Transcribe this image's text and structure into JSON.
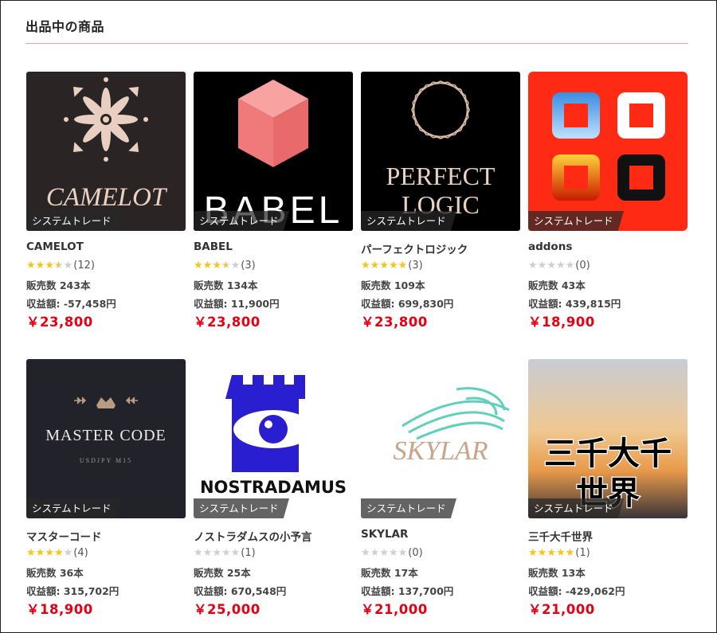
{
  "page": {
    "title": "出品中の商品"
  },
  "colors": {
    "price": "#e60012",
    "star": "#f5c518",
    "star_empty": "#cfcfcf",
    "rule": "#f2a4a4"
  },
  "products": [
    {
      "name": "CAMELOT",
      "tag": "システムトレード",
      "rating": 3.5,
      "reviews": "(12)",
      "sales": "販売数 243本",
      "profit": "収益額: -57,458円",
      "price": "￥23,800",
      "thumb": {
        "bg": "#2a2524",
        "art": "ornament",
        "label": "CAMELOT"
      }
    },
    {
      "name": "BABEL",
      "tag": "システムトレード",
      "rating": 3.5,
      "reviews": "(3)",
      "sales": "販売数 134本",
      "profit": "収益額: 11,900円",
      "price": "￥23,800",
      "thumb": {
        "bg": "#000000",
        "art": "cube",
        "label": "BABEL"
      }
    },
    {
      "name": "パーフェクトロジック",
      "tag": "システムトレード",
      "rating": 5,
      "reviews": "(3)",
      "sales": "販売数 109本",
      "profit": "収益額: 699,830円",
      "price": "￥23,800",
      "thumb": {
        "bg": "#000000",
        "art": "octagon",
        "label": "PERFECT",
        "label2": "LOGIC"
      }
    },
    {
      "name": "addons",
      "tag": "システムトレード",
      "rating": 0,
      "reviews": "(0)",
      "sales": "販売数 43本",
      "profit": "収益額: 439,815円",
      "price": "￥18,900",
      "thumb": {
        "bg": "#ff2a14",
        "art": "tiles",
        "label": ""
      }
    },
    {
      "name": "マスターコード",
      "tag": "システムトレード",
      "rating": 4,
      "reviews": "(4)",
      "sales": "販売数 36本",
      "profit": "収益額: 315,702円",
      "price": "￥18,900",
      "thumb": {
        "bg": "#22232a",
        "art": "lion",
        "label": "MASTER CODE",
        "label2": "USDJPY M15"
      }
    },
    {
      "name": "ノストラダムスの小予言",
      "tag": "システムトレード",
      "rating": 0,
      "reviews": "(1)",
      "sales": "販売数 25本",
      "profit": "収益額: 670,548円",
      "price": "￥25,000",
      "thumb": {
        "bg": "#ffffff",
        "art": "eye",
        "label": "NOSTRADAMUS"
      }
    },
    {
      "name": "SKYLAR",
      "tag": "システムトレード",
      "rating": 0,
      "reviews": "(0)",
      "sales": "販売数 17本",
      "profit": "収益額: 137,700円",
      "price": "￥21,000",
      "thumb": {
        "bg": "#ffffff",
        "art": "wave",
        "label": "SKYLAR"
      }
    },
    {
      "name": "三千大千世界",
      "tag": "システムトレード",
      "rating": 5,
      "reviews": "(1)",
      "sales": "販売数 13本",
      "profit": "収益額: -429,062円",
      "price": "￥21,000",
      "thumb": {
        "bg": "#8a7a70",
        "art": "sunset",
        "label": "三千大千",
        "label2": "世界"
      }
    }
  ]
}
